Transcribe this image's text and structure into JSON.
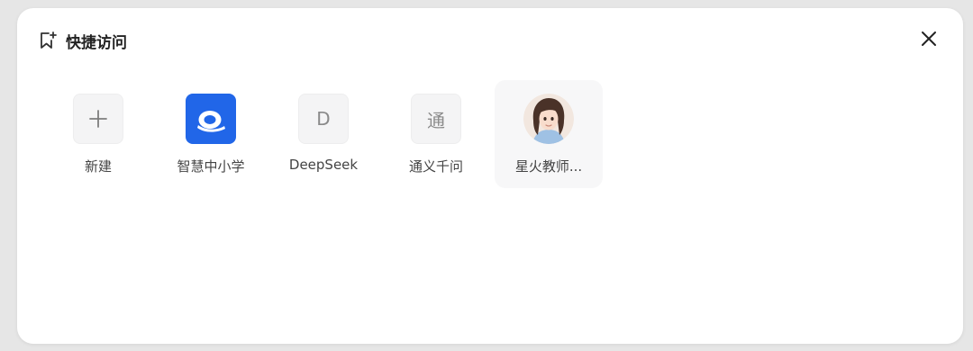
{
  "dialog": {
    "title": "快捷访问",
    "title_icon": "bookmark-plus-icon",
    "close_icon": "close-icon"
  },
  "items": [
    {
      "label": "新建",
      "icon": "plus-icon",
      "glyph": "+"
    },
    {
      "label": "智慧中小学",
      "icon": "zhihui-app-logo",
      "color": "#2166e8"
    },
    {
      "label": "DeepSeek",
      "icon": "letter-d-icon",
      "glyph": "D"
    },
    {
      "label": "通义千问",
      "icon": "letter-tong-icon",
      "glyph": "通"
    },
    {
      "label": "星火教师...",
      "icon": "avatar-girl-icon",
      "selected": true
    }
  ]
}
